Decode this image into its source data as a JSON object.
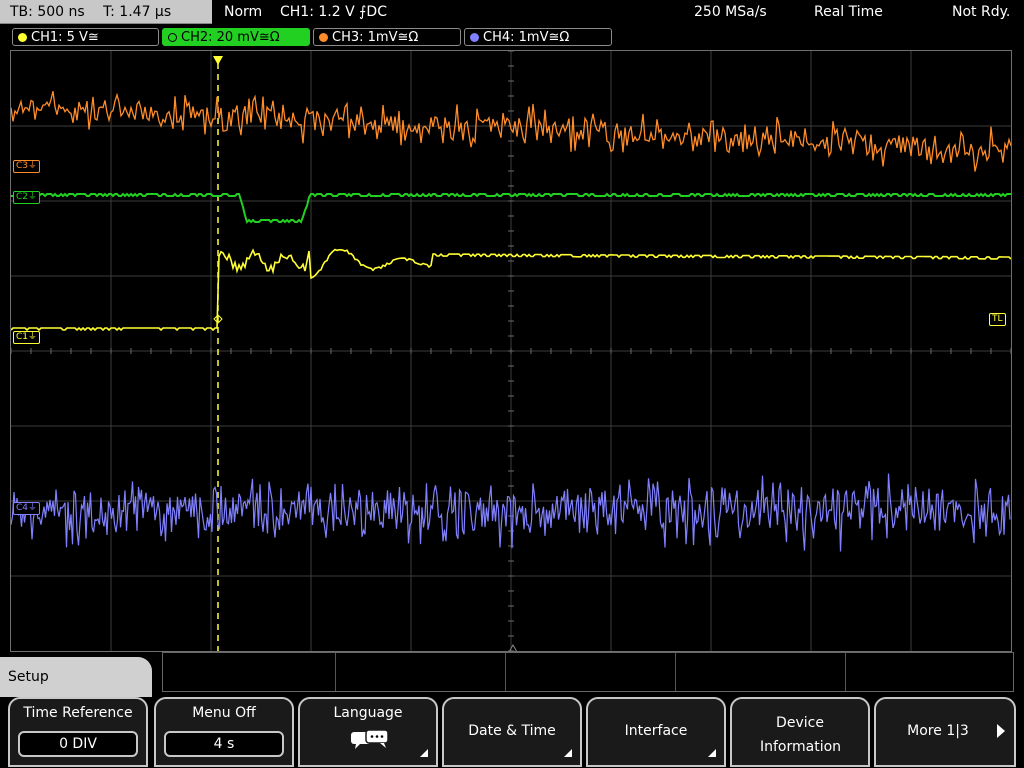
{
  "status": {
    "timebase": "TB: 500 ns",
    "trigger_time": "T: 1.47 µs",
    "trigger_mode": "Norm",
    "trigger_source": "CH1: 1.2 V ⨍DC",
    "sample_rate": "250 MSa/s",
    "acq_mode": "Real Time",
    "ready_state": "Not Rdy."
  },
  "channels": [
    {
      "label": "CH1: 5 V≅",
      "color": "#ffff33"
    },
    {
      "label": "CH2: 20 mV≅Ω",
      "color": "#22d022"
    },
    {
      "label": "CH3: 1mV≅Ω",
      "color": "#ff8c2a"
    },
    {
      "label": "CH4: 1mV≅Ω",
      "color": "#8080ff"
    }
  ],
  "markers": {
    "c3": "C3⏚",
    "c2": "C2⏚",
    "c1": "C1⏚",
    "c4": "C4⏚",
    "trigger_level": "TL",
    "trigger_pos": "T"
  },
  "menu": {
    "title": "Setup",
    "softkeys": [
      {
        "label": "Time Reference",
        "value": "0 DIV"
      },
      {
        "label": "Menu Off",
        "value": "4 s"
      },
      {
        "label": "Language",
        "icon": "speech-bubbles-icon"
      },
      {
        "label": "Date & Time"
      },
      {
        "label": "Interface"
      },
      {
        "label": "Device Information"
      },
      {
        "label": "More 1|3"
      }
    ]
  }
}
